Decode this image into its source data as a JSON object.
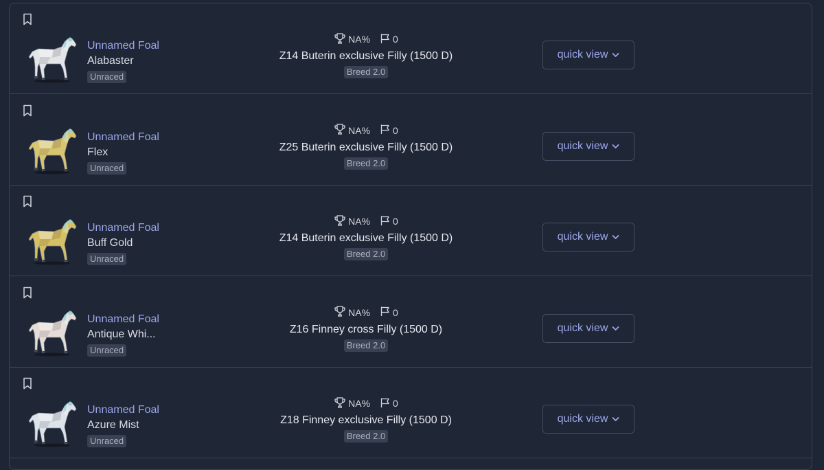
{
  "theme": {
    "accent": "#9aa8ea",
    "background": "#1e2535",
    "badge_bg": "#3a4152"
  },
  "rows": [
    {
      "name": "Unnamed Foal",
      "coat": "Alabaster",
      "status": "Unraced",
      "win_rate": "NA%",
      "races": "0",
      "description": "Z14 Buterin exclusive Filly (1500 D)",
      "breed": "Breed 2.0",
      "button": "quick view",
      "horse_color": "#e4e5e8"
    },
    {
      "name": "Unnamed Foal",
      "coat": "Flex",
      "status": "Unraced",
      "win_rate": "NA%",
      "races": "0",
      "description": "Z25 Buterin exclusive Filly (1500 D)",
      "breed": "Breed 2.0",
      "button": "quick view",
      "horse_color": "#d8c570"
    },
    {
      "name": "Unnamed Foal",
      "coat": "Buff Gold",
      "status": "Unraced",
      "win_rate": "NA%",
      "races": "0",
      "description": "Z14 Buterin exclusive Filly (1500 D)",
      "breed": "Breed 2.0",
      "button": "quick view",
      "horse_color": "#d6c064"
    },
    {
      "name": "Unnamed Foal",
      "coat": "Antique Whi...",
      "status": "Unraced",
      "win_rate": "NA%",
      "races": "0",
      "description": "Z16 Finney cross Filly (1500 D)",
      "breed": "Breed 2.0",
      "button": "quick view",
      "horse_color": "#e6ddd8"
    },
    {
      "name": "Unnamed Foal",
      "coat": "Azure Mist",
      "status": "Unraced",
      "win_rate": "NA%",
      "races": "0",
      "description": "Z18 Finney exclusive Filly (1500 D)",
      "breed": "Breed 2.0",
      "button": "quick view",
      "horse_color": "#dde3ea"
    }
  ],
  "icons": {
    "bookmark": "bookmark-icon",
    "win_rate": "trophy-icon",
    "races": "flag-icon",
    "button": "chevron-down-icon"
  }
}
